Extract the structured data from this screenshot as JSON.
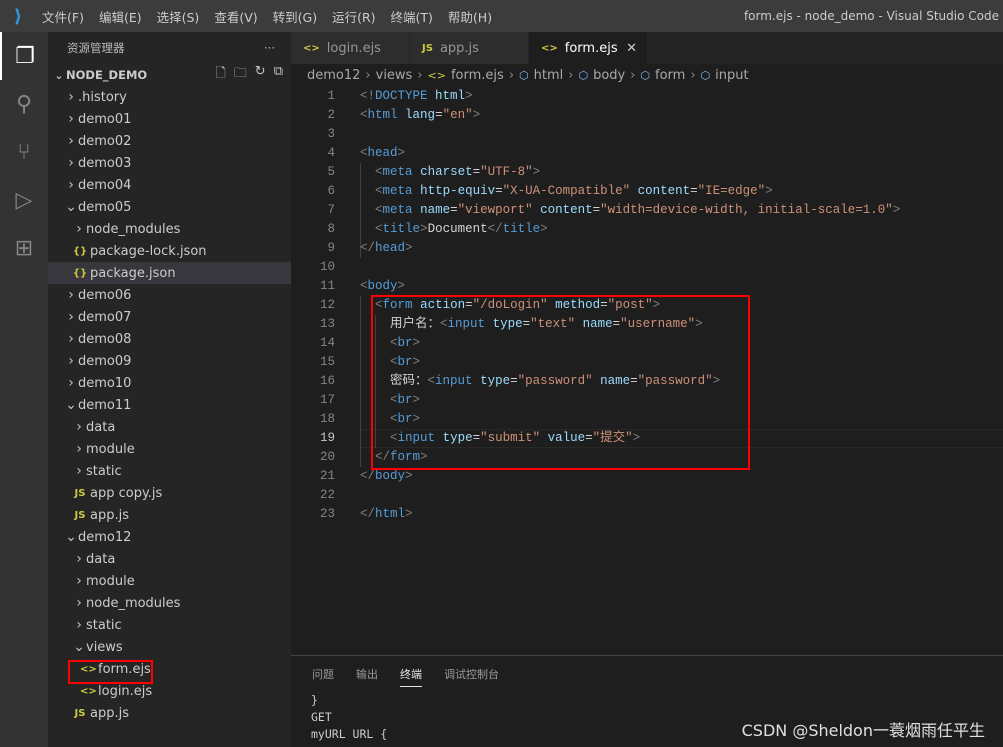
{
  "title_bar": {
    "menus": [
      "文件(F)",
      "编辑(E)",
      "选择(S)",
      "查看(V)",
      "转到(G)",
      "运行(R)",
      "终端(T)",
      "帮助(H)"
    ],
    "window_title": "form.ejs - node_demo - Visual Studio Code"
  },
  "activity_bar": [
    "files-icon",
    "search-icon",
    "source-control-icon",
    "run-debug-icon",
    "extensions-icon"
  ],
  "sidebar": {
    "title": "资源管理器",
    "more": "···",
    "project": "NODE_DEMO",
    "items": [
      {
        "label": ".history",
        "depth": 0,
        "kind": "folder",
        "open": false
      },
      {
        "label": "demo01",
        "depth": 0,
        "kind": "folder",
        "open": false
      },
      {
        "label": "demo02",
        "depth": 0,
        "kind": "folder",
        "open": false
      },
      {
        "label": "demo03",
        "depth": 0,
        "kind": "folder",
        "open": false
      },
      {
        "label": "demo04",
        "depth": 0,
        "kind": "folder",
        "open": false
      },
      {
        "label": "demo05",
        "depth": 0,
        "kind": "folder",
        "open": true
      },
      {
        "label": "node_modules",
        "depth": 1,
        "kind": "folder",
        "open": false
      },
      {
        "label": "package-lock.json",
        "depth": 1,
        "kind": "json"
      },
      {
        "label": "package.json",
        "depth": 1,
        "kind": "json",
        "selected": true
      },
      {
        "label": "demo06",
        "depth": 0,
        "kind": "folder",
        "open": false
      },
      {
        "label": "demo07",
        "depth": 0,
        "kind": "folder",
        "open": false
      },
      {
        "label": "demo08",
        "depth": 0,
        "kind": "folder",
        "open": false
      },
      {
        "label": "demo09",
        "depth": 0,
        "kind": "folder",
        "open": false
      },
      {
        "label": "demo10",
        "depth": 0,
        "kind": "folder",
        "open": false
      },
      {
        "label": "demo11",
        "depth": 0,
        "kind": "folder",
        "open": true
      },
      {
        "label": "data",
        "depth": 1,
        "kind": "folder",
        "open": false
      },
      {
        "label": "module",
        "depth": 1,
        "kind": "folder",
        "open": false
      },
      {
        "label": "static",
        "depth": 1,
        "kind": "folder",
        "open": false
      },
      {
        "label": "app copy.js",
        "depth": 1,
        "kind": "js"
      },
      {
        "label": "app.js",
        "depth": 1,
        "kind": "js"
      },
      {
        "label": "demo12",
        "depth": 0,
        "kind": "folder",
        "open": true
      },
      {
        "label": "data",
        "depth": 1,
        "kind": "folder",
        "open": false
      },
      {
        "label": "module",
        "depth": 1,
        "kind": "folder",
        "open": false
      },
      {
        "label": "node_modules",
        "depth": 1,
        "kind": "folder",
        "open": false
      },
      {
        "label": "static",
        "depth": 1,
        "kind": "folder",
        "open": false
      },
      {
        "label": "views",
        "depth": 1,
        "kind": "folder",
        "open": true
      },
      {
        "label": "form.ejs",
        "depth": 2,
        "kind": "ejs",
        "highlighted": true
      },
      {
        "label": "login.ejs",
        "depth": 2,
        "kind": "ejs"
      },
      {
        "label": "app.js",
        "depth": 1,
        "kind": "js"
      }
    ]
  },
  "tabs": [
    {
      "label": "login.ejs",
      "icon": "<>"
    },
    {
      "label": "app.js",
      "icon": "JS"
    },
    {
      "label": "form.ejs",
      "icon": "<>",
      "active": true,
      "close": "✕"
    }
  ],
  "breadcrumb": [
    "demo12",
    "views",
    "form.ejs",
    "html",
    "body",
    "form",
    "input"
  ],
  "code": {
    "current_line": 19,
    "lines": [
      [
        [
          "p",
          "<!"
        ],
        [
          "t",
          "DOCTYPE"
        ],
        [
          "x",
          " "
        ],
        [
          "a",
          "html"
        ],
        [
          "p",
          ">"
        ]
      ],
      [
        [
          "p",
          "<"
        ],
        [
          "t",
          "html"
        ],
        [
          "x",
          " "
        ],
        [
          "a",
          "lang"
        ],
        [
          "x",
          "="
        ],
        [
          "s",
          "\"en\""
        ],
        [
          "p",
          ">"
        ]
      ],
      [],
      [
        [
          "p",
          "<"
        ],
        [
          "t",
          "head"
        ],
        [
          "p",
          ">"
        ]
      ],
      [
        [
          "x",
          "  "
        ],
        [
          "p",
          "<"
        ],
        [
          "t",
          "meta"
        ],
        [
          "x",
          " "
        ],
        [
          "a",
          "charset"
        ],
        [
          "x",
          "="
        ],
        [
          "s",
          "\"UTF-8\""
        ],
        [
          "p",
          ">"
        ]
      ],
      [
        [
          "x",
          "  "
        ],
        [
          "p",
          "<"
        ],
        [
          "t",
          "meta"
        ],
        [
          "x",
          " "
        ],
        [
          "a",
          "http-equiv"
        ],
        [
          "x",
          "="
        ],
        [
          "s",
          "\"X-UA-Compatible\""
        ],
        [
          "x",
          " "
        ],
        [
          "a",
          "content"
        ],
        [
          "x",
          "="
        ],
        [
          "s",
          "\"IE=edge\""
        ],
        [
          "p",
          ">"
        ]
      ],
      [
        [
          "x",
          "  "
        ],
        [
          "p",
          "<"
        ],
        [
          "t",
          "meta"
        ],
        [
          "x",
          " "
        ],
        [
          "a",
          "name"
        ],
        [
          "x",
          "="
        ],
        [
          "s",
          "\"viewport\""
        ],
        [
          "x",
          " "
        ],
        [
          "a",
          "content"
        ],
        [
          "x",
          "="
        ],
        [
          "s",
          "\"width=device-width, initial-scale=1.0\""
        ],
        [
          "p",
          ">"
        ]
      ],
      [
        [
          "x",
          "  "
        ],
        [
          "p",
          "<"
        ],
        [
          "t",
          "title"
        ],
        [
          "p",
          ">"
        ],
        [
          "x",
          "Document"
        ],
        [
          "p",
          "</"
        ],
        [
          "t",
          "title"
        ],
        [
          "p",
          ">"
        ]
      ],
      [
        [
          "p",
          "</"
        ],
        [
          "t",
          "head"
        ],
        [
          "p",
          ">"
        ]
      ],
      [],
      [
        [
          "p",
          "<"
        ],
        [
          "t",
          "body"
        ],
        [
          "p",
          ">"
        ]
      ],
      [
        [
          "x",
          "  "
        ],
        [
          "p",
          "<"
        ],
        [
          "t",
          "form"
        ],
        [
          "x",
          " "
        ],
        [
          "a",
          "action"
        ],
        [
          "x",
          "="
        ],
        [
          "s",
          "\"/doLogin\""
        ],
        [
          "x",
          " "
        ],
        [
          "a",
          "method"
        ],
        [
          "x",
          "="
        ],
        [
          "s",
          "\"post\""
        ],
        [
          "p",
          ">"
        ]
      ],
      [
        [
          "x",
          "    用户名："
        ],
        [
          "p",
          "<"
        ],
        [
          "t",
          "input"
        ],
        [
          "x",
          " "
        ],
        [
          "a",
          "type"
        ],
        [
          "x",
          "="
        ],
        [
          "s",
          "\"text\""
        ],
        [
          "x",
          " "
        ],
        [
          "a",
          "name"
        ],
        [
          "x",
          "="
        ],
        [
          "s",
          "\"username\""
        ],
        [
          "p",
          ">"
        ]
      ],
      [
        [
          "x",
          "    "
        ],
        [
          "p",
          "<"
        ],
        [
          "t",
          "br"
        ],
        [
          "p",
          ">"
        ]
      ],
      [
        [
          "x",
          "    "
        ],
        [
          "p",
          "<"
        ],
        [
          "t",
          "br"
        ],
        [
          "p",
          ">"
        ]
      ],
      [
        [
          "x",
          "    密码："
        ],
        [
          "p",
          "<"
        ],
        [
          "t",
          "input"
        ],
        [
          "x",
          " "
        ],
        [
          "a",
          "type"
        ],
        [
          "x",
          "="
        ],
        [
          "s",
          "\"password\""
        ],
        [
          "x",
          " "
        ],
        [
          "a",
          "name"
        ],
        [
          "x",
          "="
        ],
        [
          "s",
          "\"password\""
        ],
        [
          "p",
          ">"
        ]
      ],
      [
        [
          "x",
          "    "
        ],
        [
          "p",
          "<"
        ],
        [
          "t",
          "br"
        ],
        [
          "p",
          ">"
        ]
      ],
      [
        [
          "x",
          "    "
        ],
        [
          "p",
          "<"
        ],
        [
          "t",
          "br"
        ],
        [
          "p",
          ">"
        ]
      ],
      [
        [
          "x",
          "    "
        ],
        [
          "p",
          "<"
        ],
        [
          "t",
          "input"
        ],
        [
          "x",
          " "
        ],
        [
          "a",
          "type"
        ],
        [
          "x",
          "="
        ],
        [
          "s",
          "\"submit\""
        ],
        [
          "x",
          " "
        ],
        [
          "a",
          "value"
        ],
        [
          "x",
          "="
        ],
        [
          "s",
          "\"提交\""
        ],
        [
          "p",
          ">"
        ]
      ],
      [
        [
          "x",
          "  "
        ],
        [
          "p",
          "</"
        ],
        [
          "t",
          "form"
        ],
        [
          "p",
          ">"
        ]
      ],
      [
        [
          "p",
          "</"
        ],
        [
          "t",
          "body"
        ],
        [
          "p",
          ">"
        ]
      ],
      [],
      [
        [
          "p",
          "</"
        ],
        [
          "t",
          "html"
        ],
        [
          "p",
          ">"
        ]
      ]
    ]
  },
  "panel": {
    "tabs": [
      "问题",
      "输出",
      "终端",
      "调试控制台"
    ],
    "active": "终端",
    "terminal": [
      "}",
      "GET",
      "myURL URL {"
    ]
  },
  "watermark": "CSDN @Sheldon一蓑烟雨任平生",
  "colors": {
    "highlight": "#ff0000",
    "tag": "#569cd6",
    "attr": "#9cdcfe",
    "string": "#ce9178"
  }
}
